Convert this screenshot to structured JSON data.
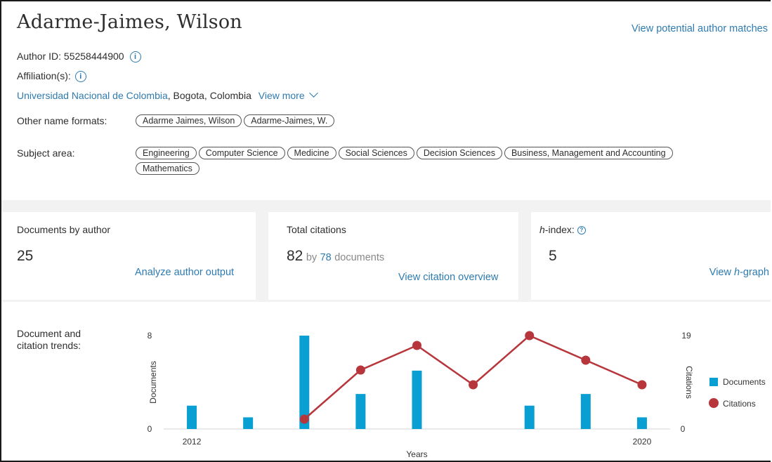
{
  "author": {
    "name": "Adarme-Jaimes, Wilson",
    "view_matches": "View potential author matches",
    "author_id_label": "Author ID: 55258444900",
    "affiliations_label": "Affiliation(s):",
    "affiliation_institution": "Universidad Nacional de Colombia",
    "affiliation_location": ", Bogota, Colombia",
    "view_more": "View more",
    "other_name_formats_label": "Other name formats:",
    "other_name_formats": [
      "Adarme Jaimes, Wilson",
      "Adarme-Jaimes, W."
    ],
    "subject_area_label": "Subject area:",
    "subject_areas": [
      "Engineering",
      "Computer Science",
      "Medicine",
      "Social Sciences",
      "Decision Sciences",
      "Business, Management and Accounting",
      "Mathematics"
    ]
  },
  "metrics": {
    "documents": {
      "title": "Documents by author",
      "value": "25",
      "link": "Analyze author output"
    },
    "citations": {
      "title": "Total citations",
      "value": "82",
      "by": "by",
      "doc_count": "78",
      "doc_word": "documents",
      "link": "View citation overview"
    },
    "hindex": {
      "title_italic": "h",
      "title_rest": "-index:",
      "value": "5",
      "link_prefix": "View ",
      "link_italic": "h",
      "link_suffix": "-graph"
    }
  },
  "trends_label_line1": "Document and",
  "trends_label_line2": "citation trends:",
  "colors": {
    "link": "#2e7bb1",
    "documents": "#0a9fd3",
    "citations": "#b7363c"
  },
  "chart_data": {
    "type": "bar+line",
    "x": [
      2012,
      2013,
      2014,
      2015,
      2016,
      2017,
      2018,
      2019,
      2020
    ],
    "x_tick_labels": [
      "2012",
      "2020"
    ],
    "xlabel": "Years",
    "ylabel_left": "Documents",
    "ylabel_right": "Citations",
    "ylim_left": [
      0,
      8
    ],
    "ylim_right": [
      0,
      19
    ],
    "series": [
      {
        "name": "Documents",
        "type": "bar",
        "axis": "left",
        "values": [
          2,
          1,
          8,
          3,
          5,
          null,
          2,
          3,
          1
        ]
      },
      {
        "name": "Citations",
        "type": "line",
        "axis": "right",
        "values": [
          null,
          null,
          2,
          12,
          17,
          9,
          19,
          14,
          9
        ]
      }
    ],
    "legend_placement": "right"
  }
}
